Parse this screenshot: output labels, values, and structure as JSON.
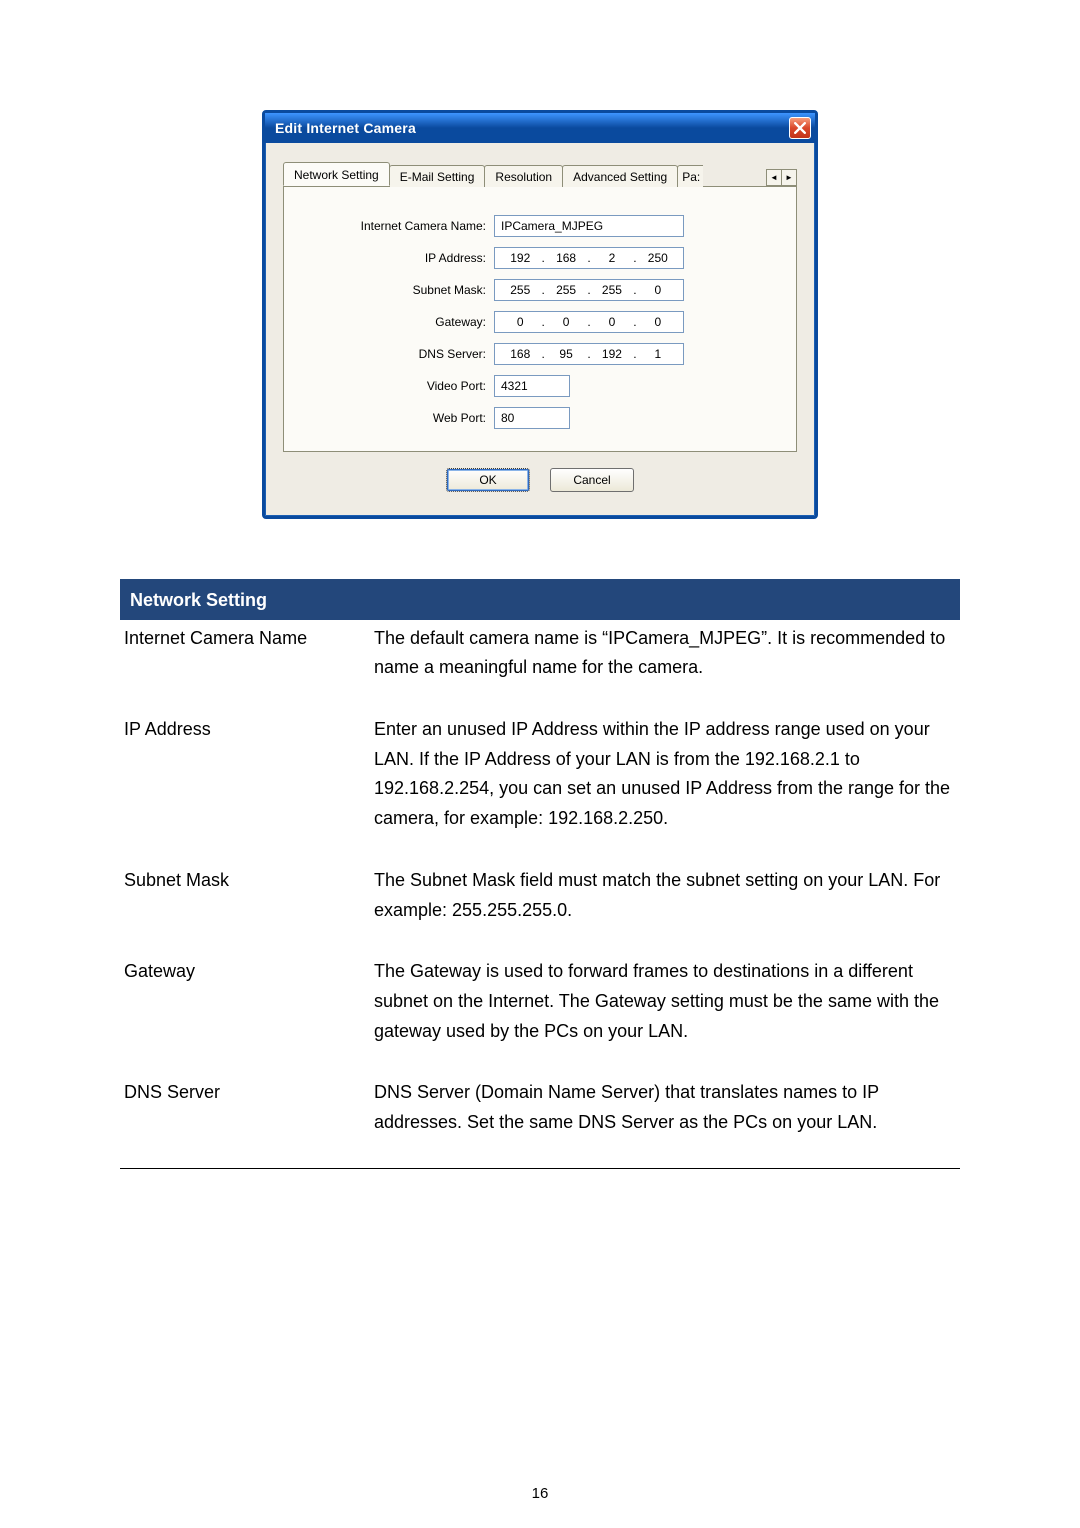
{
  "dialog": {
    "title": "Edit Internet Camera",
    "tabs": {
      "network": "Network Setting",
      "email": "E-Mail Setting",
      "resolution": "Resolution",
      "advanced": "Advanced Setting",
      "partial": "Pa:"
    },
    "labels": {
      "camera_name": "Internet Camera Name:",
      "ip_address": "IP Address:",
      "subnet_mask": "Subnet Mask:",
      "gateway": "Gateway:",
      "dns_server": "DNS Server:",
      "video_port": "Video Port:",
      "web_port": "Web Port:"
    },
    "values": {
      "camera_name": "IPCamera_MJPEG",
      "ip": [
        "192",
        "168",
        "2",
        "250"
      ],
      "subnet": [
        "255",
        "255",
        "255",
        "0"
      ],
      "gateway": [
        "0",
        "0",
        "0",
        "0"
      ],
      "dns": [
        "168",
        "95",
        "192",
        "1"
      ],
      "video_port": "4321",
      "web_port": "80"
    },
    "buttons": {
      "ok": "OK",
      "cancel": "Cancel"
    }
  },
  "section": {
    "header": "Network Setting",
    "rows": {
      "camera_name": {
        "term": "Internet Camera Name",
        "body": "The default camera name is “IPCamera_MJPEG”. It is recommended to name a meaningful name for the camera."
      },
      "ip": {
        "term": "IP Address",
        "body": "Enter an unused IP Address within the IP address range used on your LAN. If the IP Address of your LAN is from the 192.168.2.1 to 192.168.2.254, you can set an unused IP Address from the range for the camera, for example: 192.168.2.250."
      },
      "subnet": {
        "term": "Subnet Mask",
        "body": "The Subnet Mask field must match the subnet setting on your LAN. For example: 255.255.255.0."
      },
      "gateway": {
        "term": "Gateway",
        "body": "The Gateway is used to forward frames to destinations in a different subnet on the Internet. The Gateway setting must be the same with the gateway used by the PCs on your LAN."
      },
      "dns": {
        "term": "DNS Server",
        "body": "DNS Server (Domain Name Server) that translates names to IP addresses. Set the same DNS Server as the PCs on your LAN."
      }
    }
  },
  "page_number": "16"
}
